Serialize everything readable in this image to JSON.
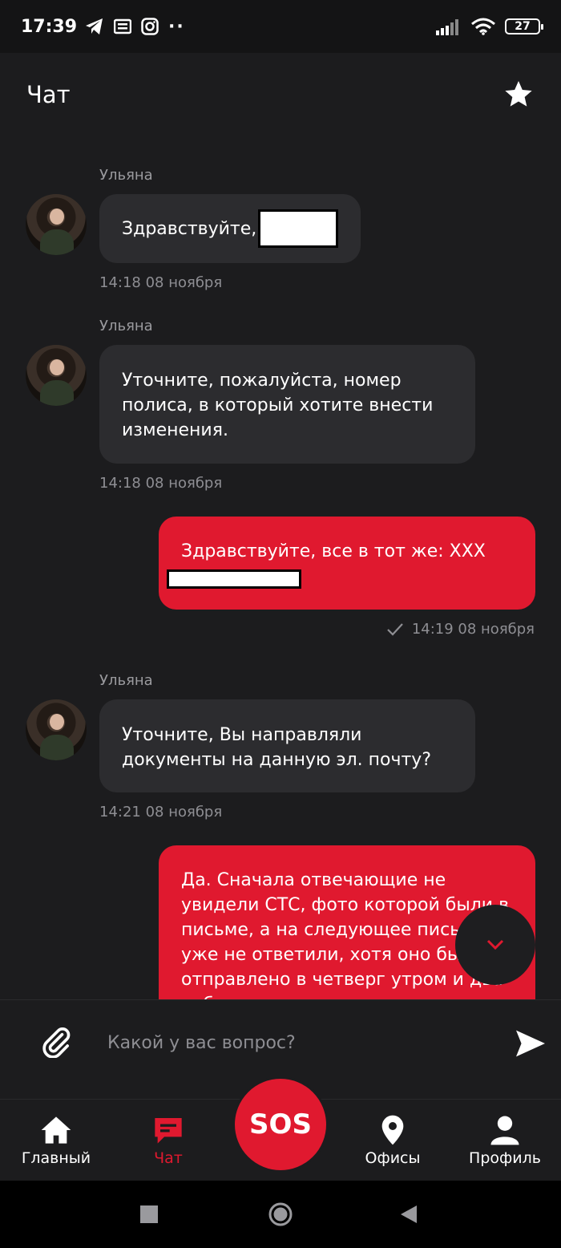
{
  "statusbar": {
    "time": "17:39",
    "battery": "27"
  },
  "header": {
    "title": "Чат"
  },
  "messages": [
    {
      "sender": "Ульяна",
      "text": "Здравствуйте,",
      "time": "14:18 08 ноября"
    },
    {
      "sender": "Ульяна",
      "lines": [
        "Уточните, пожалуйста, номер",
        "полиса, в который хотите внести",
        "изменения."
      ],
      "time": "14:18 08 ноября"
    },
    {
      "text": "Здравствуйте, все в тот же: XXX",
      "time": "14:19 08 ноября"
    },
    {
      "sender": "Ульяна",
      "lines": [
        "Уточните, Вы направляли",
        "документы на данную эл. почту?"
      ],
      "time": "14:21 08 ноября"
    },
    {
      "lines": [
        "Да. Сначала отвечающие не",
        "увидели СТС,  фото которой были в",
        "письме, а на следующее письмо",
        "уже не ответили, хотя оно было",
        "отправлено в четверг утром и два",
        "рабочих дня прошло уже."
      ]
    }
  ],
  "composer": {
    "placeholder": "Какой у вас вопрос?"
  },
  "tabs": [
    {
      "label": "Главный"
    },
    {
      "label": "Чат"
    },
    {
      "label": "SOS"
    },
    {
      "label": "Офисы"
    },
    {
      "label": "Профиль"
    }
  ],
  "colors": {
    "accent": "#e0192f",
    "background": "#1c1c1e",
    "bubble_in": "#2c2c2f"
  },
  "icons": [
    "telegram-icon",
    "news-icon",
    "instagram-icon",
    "signal-icon",
    "wifi-icon",
    "battery-icon",
    "star-icon",
    "paperclip-icon",
    "send-icon",
    "home-icon",
    "chat-icon",
    "location-pin-icon",
    "person-icon",
    "chevron-down-icon"
  ]
}
